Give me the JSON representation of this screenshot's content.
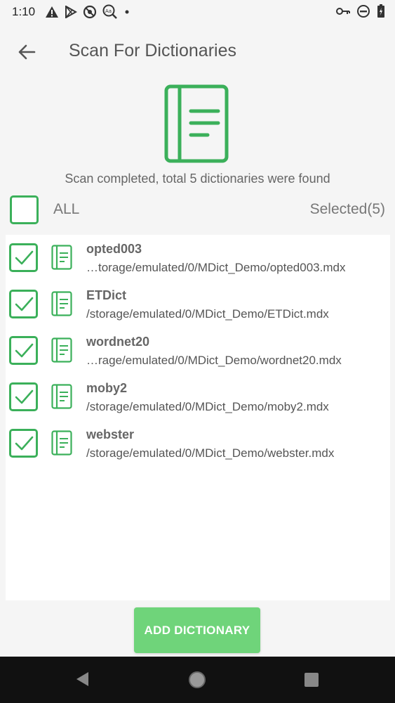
{
  "status_bar": {
    "time": "1:10",
    "left_icons": [
      "warning-icon",
      "play-store-icon",
      "do-not-disturb-app-icon",
      "dictionary-notification-icon",
      "dot-icon"
    ],
    "right_icons": [
      "vpn-key-icon",
      "do-not-disturb-icon",
      "battery-icon"
    ]
  },
  "app_bar": {
    "title": "Scan For Dictionaries"
  },
  "scan": {
    "message": "Scan completed, total 5 dictionaries were found"
  },
  "select_all": {
    "label": "ALL",
    "checked": false,
    "selected_text": "Selected(5)"
  },
  "dictionaries": [
    {
      "name": "opted003",
      "path": "…torage/emulated/0/MDict_Demo/opted003.mdx",
      "checked": true
    },
    {
      "name": "ETDict",
      "path": "/storage/emulated/0/MDict_Demo/ETDict.mdx",
      "checked": true
    },
    {
      "name": "wordnet20",
      "path": "…rage/emulated/0/MDict_Demo/wordnet20.mdx",
      "checked": true
    },
    {
      "name": "moby2",
      "path": "/storage/emulated/0/MDict_Demo/moby2.mdx",
      "checked": true
    },
    {
      "name": "webster",
      "path": "/storage/emulated/0/MDict_Demo/webster.mdx",
      "checked": true
    }
  ],
  "actions": {
    "add_label": "ADD DICTIONARY"
  },
  "colors": {
    "accent": "#3bb05a",
    "button": "#6fd47a"
  }
}
